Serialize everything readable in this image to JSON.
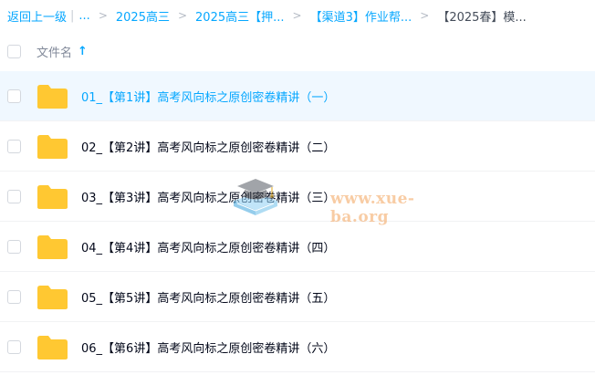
{
  "breadcrumb": {
    "back_label": "返回上一级",
    "ellipsis": "...",
    "items": [
      "2025高三",
      "2025高三【押...",
      "【渠道3】作业帮...",
      "【2025春】模..."
    ],
    "separator": ">"
  },
  "header": {
    "column_label": "文件名",
    "sort_icon": "sort-ascending-arrow-icon",
    "sort_glyph": "↑"
  },
  "rows": [
    {
      "name": "01_【第1讲】高考风向标之原创密卷精讲（一）",
      "icon": "folder-icon",
      "selected": true
    },
    {
      "name": "02_【第2讲】高考风向标之原创密卷精讲（二）",
      "icon": "folder-icon",
      "selected": false
    },
    {
      "name": "03_【第3讲】高考风向标之原创密卷精讲（三）",
      "icon": "folder-icon",
      "selected": false
    },
    {
      "name": "04_【第4讲】高考风向标之原创密卷精讲（四）",
      "icon": "folder-icon",
      "selected": false
    },
    {
      "name": "05_【第5讲】高考风向标之原创密卷精讲（五）",
      "icon": "folder-icon",
      "selected": false
    },
    {
      "name": "06_【第6讲】高考风向标之原创密卷精讲（六）",
      "icon": "folder-icon",
      "selected": false
    }
  ],
  "watermark": {
    "text": "www.xue-ba.org",
    "icon": "graduation-cap-books-icon"
  },
  "colors": {
    "accent": "#06a7ff",
    "folder": "#ffc832",
    "selected_row_bg": "#f0f8ff",
    "text": "#03081a",
    "muted": "#818999"
  }
}
